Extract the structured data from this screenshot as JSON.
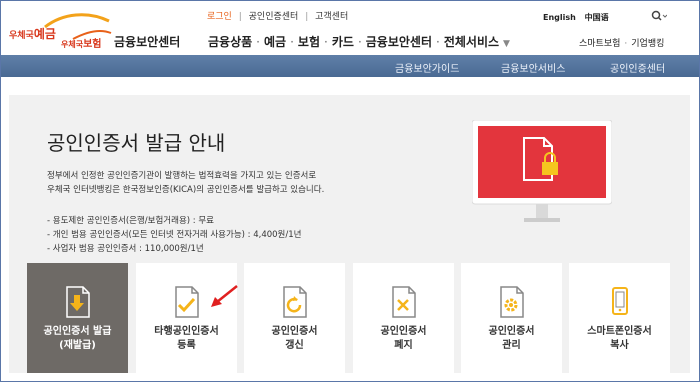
{
  "header": {
    "logo_left_small": "우체국",
    "logo_left_big": "예금",
    "logo_right_small": "우체국",
    "logo_right_big": "보험",
    "site_name": "금융보안센터",
    "util_links": [
      "로그인",
      "공인인증센터",
      "고객센터"
    ],
    "lang_links": [
      "English",
      "中国语"
    ],
    "gnb": [
      "금융상품",
      "예금",
      "보험",
      "카드",
      "금융보안센터",
      "전체서비스"
    ],
    "right_links": [
      "스마트보험",
      "기업뱅킹"
    ]
  },
  "subnav": [
    "금융보안가이드",
    "금융보안서비스",
    "공인인증센터"
  ],
  "main": {
    "title": "공인인증서 발급 안내",
    "desc": [
      "정부에서 인정한 공인인증기관이 발행하는 법적효력을 가지고 있는 인증서로",
      "우체국 인터넷뱅킹은 한국정보인증(KICA)의 공인인증서를 발급하고 있습니다."
    ],
    "bullets": [
      "- 용도제한 공인인증서(은행/보험거래용) : 무료",
      "- 개인 범용 공인인증서(모든 인터넷 전자거래 사용가능) : 4,400원/1년",
      "- 사업자 범용 공인인증서 : 110,000원/1년"
    ]
  },
  "cards": [
    {
      "line1": "공인인증서 발급",
      "line2": "(재발급)",
      "icon": "download-doc-icon",
      "active": true
    },
    {
      "line1": "타행공인인증서",
      "line2": "등록",
      "icon": "check-doc-icon",
      "active": false
    },
    {
      "line1": "공인인증서",
      "line2": "갱신",
      "icon": "refresh-doc-icon",
      "active": false
    },
    {
      "line1": "공인인증서",
      "line2": "폐지",
      "icon": "x-doc-icon",
      "active": false
    },
    {
      "line1": "공인인증서",
      "line2": "관리",
      "icon": "gear-doc-icon",
      "active": false
    },
    {
      "line1": "스마트폰인증서",
      "line2": "복사",
      "icon": "phone-doc-icon",
      "active": false
    }
  ],
  "colors": {
    "accent": "#e8611a",
    "subnav": "#5576a0",
    "monitor_screen": "#e3353d",
    "active_card": "#6e6a66",
    "annotation_arrow": "#e02020"
  }
}
